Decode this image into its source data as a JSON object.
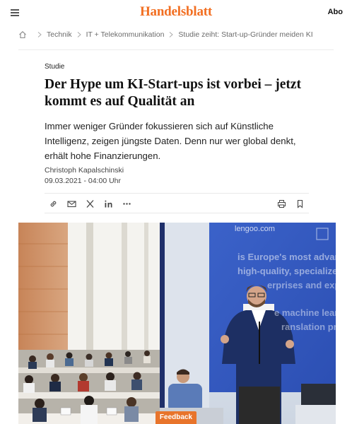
{
  "header": {
    "logo": "Handelsblatt",
    "subscribe_label": "Abo"
  },
  "breadcrumb": {
    "items": [
      "Technik",
      "IT + Telekommunikation",
      "Studie zeiht: Start-up-Gründer meiden KI"
    ]
  },
  "article": {
    "kicker": "Studie",
    "headline": "Der Hype um KI-Start-ups ist vorbei – jetzt kommt es auf Qualität an",
    "teaser": "Immer weniger Gründer fokussieren sich auf Künstliche Intelligenz, zeigen jüngste Daten. Denn nur wer global denkt, erhält hohe Finanzierungen.",
    "author": "Christoph Kapalschinski",
    "date": "09.03.2021 - 04:00 Uhr"
  },
  "share_bar": {
    "icons": [
      "link-icon",
      "mail-icon",
      "x-icon",
      "linkedin-icon",
      "more-icon",
      "print-icon",
      "bookmark-icon"
    ]
  },
  "hero_image": {
    "screen_text": [
      "lengoo.com",
      "is Europe's most advan",
      "high-quality, specialize",
      "erprises and expert",
      "e machine learni",
      "ranslation pr"
    ]
  },
  "feedback_label": "Feedback",
  "colors": {
    "brand": "#f26f22",
    "feedback": "#e8742b"
  }
}
